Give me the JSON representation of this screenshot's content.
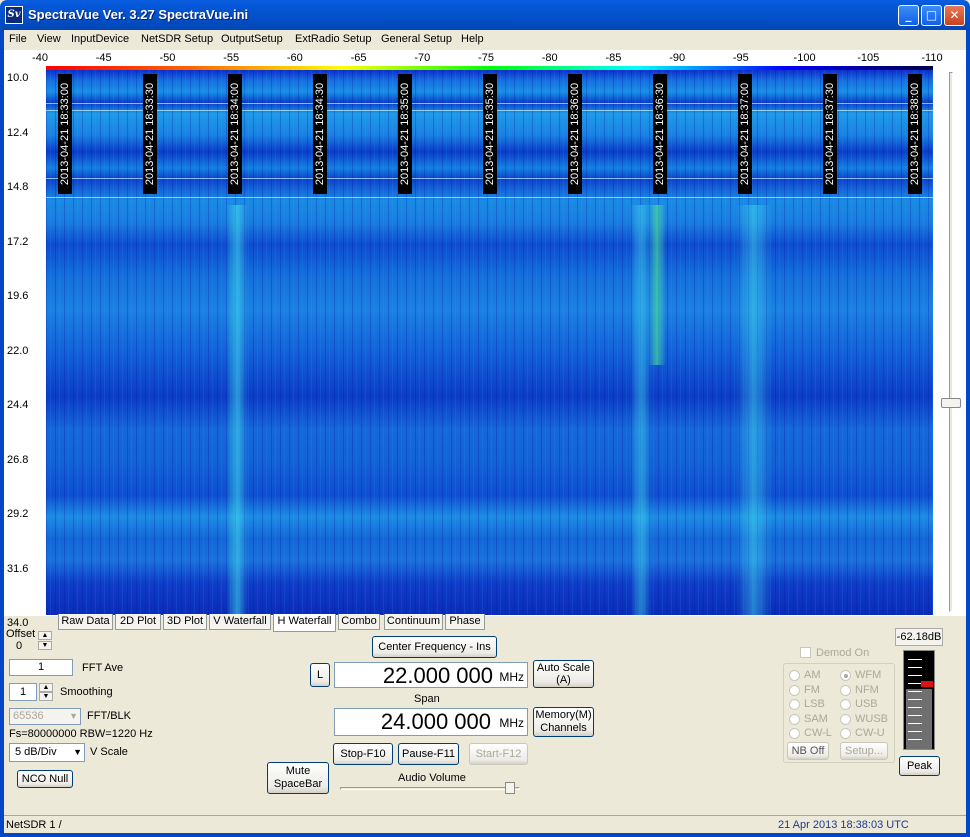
{
  "window": {
    "title": "SpectraVue Ver. 3.27  SpectraVue.ini",
    "app_icon": "Sv",
    "controls": {
      "minimize": "_",
      "maximize": "□",
      "close": "✕"
    }
  },
  "menu": [
    "File",
    "View",
    "InputDevice",
    "NetSDR Setup",
    "OutputSetup",
    "ExtRadio Setup",
    "General Setup",
    "Help"
  ],
  "x_axis_ticks": [
    "-40",
    "-45",
    "-50",
    "-55",
    "-60",
    "-65",
    "-70",
    "-75",
    "-80",
    "-85",
    "-90",
    "-95",
    "-100",
    "-105",
    "-110"
  ],
  "y_axis_ticks": [
    "10.0",
    "12.4",
    "14.8",
    "17.2",
    "19.6",
    "22.0",
    "24.4",
    "26.8",
    "29.2",
    "31.6",
    "34.0"
  ],
  "timestamps": [
    "2013-04-21 18:33:00",
    "2013-04-21 18:33:30",
    "2013-04-21 18:34:00",
    "2013-04-21 18:34:30",
    "2013-04-21 18:35:00",
    "2013-04-21 18:35:30",
    "2013-04-21 18:36:00",
    "2013-04-21 18:36:30",
    "2013-04-21 18:37:00",
    "2013-04-21 18:37:30",
    "2013-04-21 18:38:00"
  ],
  "tabs": [
    {
      "label": "Raw Data",
      "active": false
    },
    {
      "label": "2D Plot",
      "active": false
    },
    {
      "label": "3D Plot",
      "active": false
    },
    {
      "label": "V Waterfall",
      "active": false
    },
    {
      "label": "H Waterfall",
      "active": true
    },
    {
      "label": "Combo",
      "active": false
    },
    {
      "label": "Continuum",
      "active": false
    },
    {
      "label": "Phase",
      "active": false
    }
  ],
  "left_controls": {
    "offset_label": "Offset",
    "offset_value": "0",
    "fft_ave_value": "1",
    "fft_ave_label": "FFT Ave",
    "smoothing_value": "1",
    "smoothing_label": "Smoothing",
    "fft_blk_value": "65536",
    "fft_blk_label": "FFT/BLK",
    "fs_info": "Fs=80000000 RBW=1220 Hz",
    "vscale_value": "5 dB/Div",
    "vscale_label": "V Scale",
    "nco_null": "NCO Null"
  },
  "center": {
    "center_freq_button": "Center Frequency - Ins",
    "l_button": "L",
    "center_freq": "22.000 000",
    "center_unit": "MHz",
    "auto_scale": "Auto Scale\n(A)",
    "span_label": "Span",
    "span_value": "24.000 000",
    "span_unit": "MHz",
    "memory": "Memory(M)\nChannels",
    "stop": "Stop-F10",
    "pause": "Pause-F11",
    "start": "Start-F12",
    "mute": "Mute\nSpaceBar",
    "audio_volume": "Audio Volume"
  },
  "demod": {
    "demod_on": "Demod On",
    "modes_left": [
      "AM",
      "FM",
      "LSB",
      "SAM",
      "CW-L"
    ],
    "modes_right": [
      "WFM",
      "NFM",
      "USB",
      "WUSB",
      "CW-U"
    ],
    "selected": "WFM",
    "nb_off": "NB Off",
    "setup": "Setup..."
  },
  "meter": {
    "readout": "-62.18dB",
    "peak": "Peak"
  },
  "status": {
    "left": "NetSDR 1  /",
    "right": "21 Apr 2013   18:38:03 UTC"
  }
}
